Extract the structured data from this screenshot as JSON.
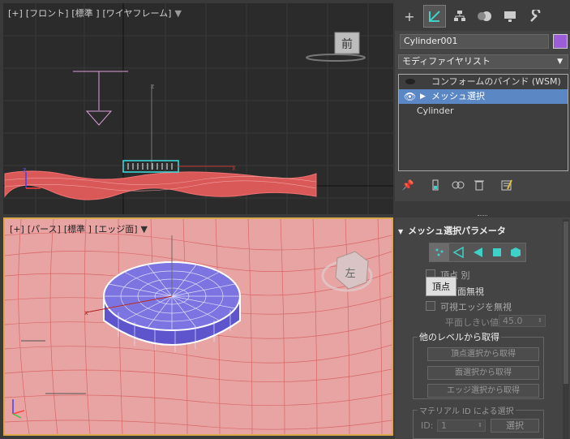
{
  "viewport_front": {
    "label_parts": [
      "[+]",
      "[フロント]",
      "[標準 ]",
      "[ワイヤフレーム]"
    ],
    "viewcube_label": "前"
  },
  "viewport_persp": {
    "label_parts": [
      "[+]",
      "[パース]",
      "[標準 ]",
      "[エッジ面]"
    ],
    "viewcube_label": "左"
  },
  "command_tabs": [
    "create-icon",
    "modify-icon",
    "hierarchy-icon",
    "motion-icon",
    "display-icon",
    "utilities-icon"
  ],
  "object_name": "Cylinder001",
  "object_color": "#9c5ed8",
  "modifier_list_label": "モディファイヤリスト",
  "stack": {
    "items": [
      {
        "label": "コンフォームのバインド (WSM)"
      },
      {
        "label": "メッシュ選択"
      },
      {
        "label": "Cylinder"
      }
    ]
  },
  "rollout": {
    "title": "メッシュ選択パラメータ",
    "checkbox_by_vertex": "頂点 別",
    "checkbox_ignore_back": "背面無視",
    "checkbox_ignore_visible": "可視エッジを無視",
    "threshold_label": "平面しきい値:",
    "threshold_value": "45.0",
    "tooltip": "頂点",
    "group_other": "他のレベルから取得",
    "btn_vertex": "頂点選択から取得",
    "btn_face": "面選択から取得",
    "btn_edge": "エッジ選択から取得",
    "group_material": "マテリアル ID による選択",
    "id_label": "ID:",
    "id_value": "1",
    "select_btn": "選択"
  }
}
